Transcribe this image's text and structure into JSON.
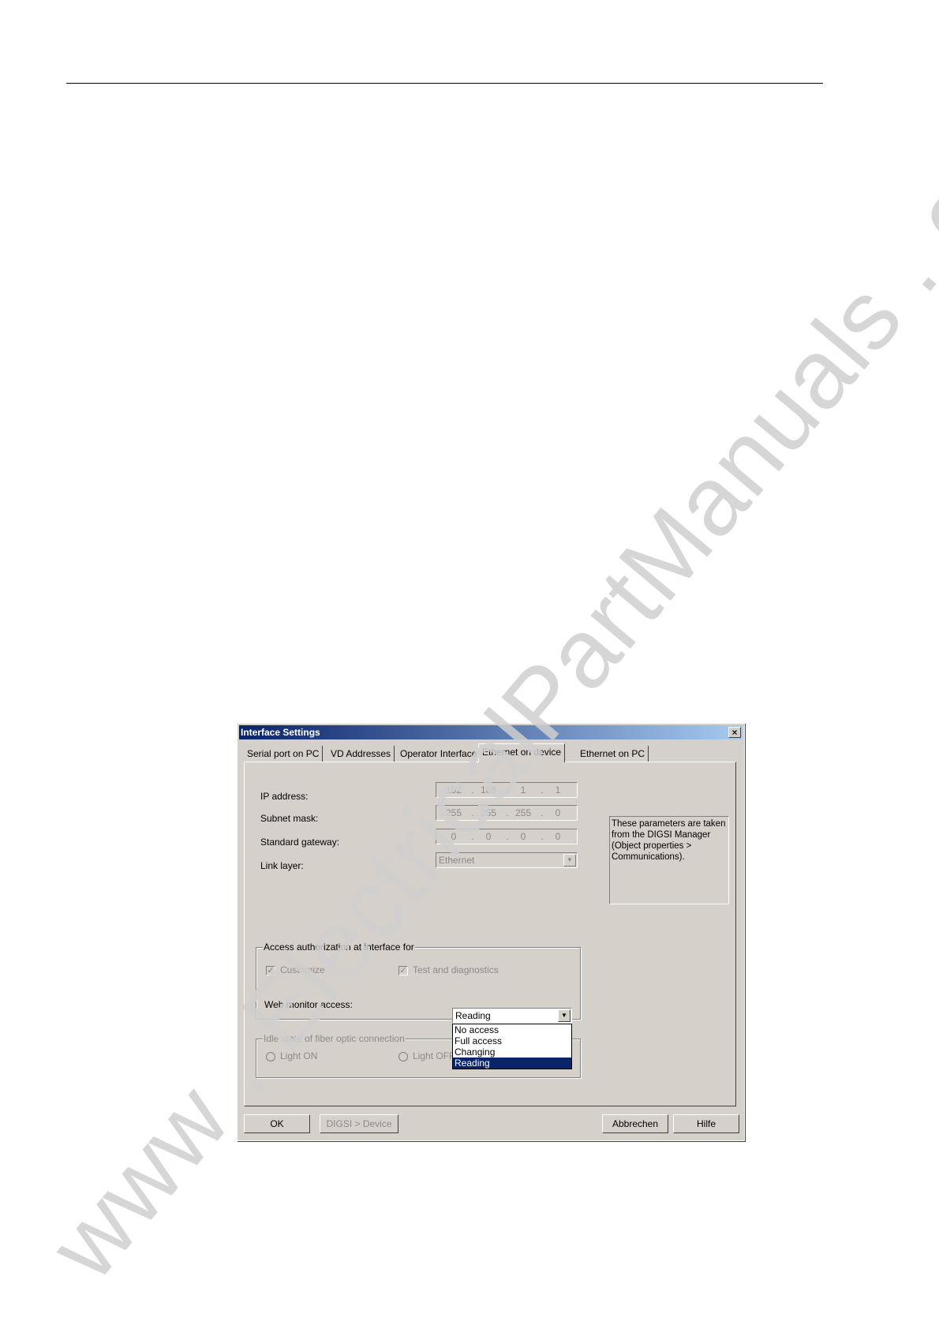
{
  "dialog": {
    "title": "Interface Settings",
    "close_glyph": "×",
    "tabs": [
      {
        "label": "Serial port on PC"
      },
      {
        "label": "VD Addresses"
      },
      {
        "label": "Operator Interface"
      },
      {
        "label": "Ethernet on device"
      },
      {
        "label": "Ethernet on PC"
      }
    ],
    "active_tab": "Ethernet on device",
    "fields": {
      "ip_label": "IP address:",
      "ip_value": [
        "192",
        "168",
        "1",
        "1"
      ],
      "subnet_label": "Subnet mask:",
      "subnet_value": [
        "255",
        "255",
        "255",
        "0"
      ],
      "gateway_label": "Standard gateway:",
      "gateway_value": [
        "0",
        "0",
        "0",
        "0"
      ],
      "link_layer_label": "Link layer:",
      "link_layer_value": "Ethernet",
      "separator": "."
    },
    "info_text": "These parameters are taken from the DIGSI Manager (Object properties > Communications).",
    "access_group": {
      "title": "Access authorization at interface for",
      "customize_label": "Customize",
      "customize_checked": true,
      "test_label": "Test and diagnostics",
      "test_checked": true,
      "web_monitor_label": "Web monitor access:",
      "web_monitor_value": "Reading",
      "web_monitor_options": [
        "No access",
        "Full access",
        "Changing",
        "Reading"
      ]
    },
    "fiber_group": {
      "title": "Idle state of fiber optic connection",
      "light_on_label": "Light ON",
      "light_off_label": "Light OFF"
    },
    "buttons": {
      "ok": "OK",
      "digsi_device": "DIGSI > Device",
      "cancel": "Abbrechen",
      "help": "Hilfe"
    }
  },
  "watermark": "www . ElectricalPartManuals . com"
}
